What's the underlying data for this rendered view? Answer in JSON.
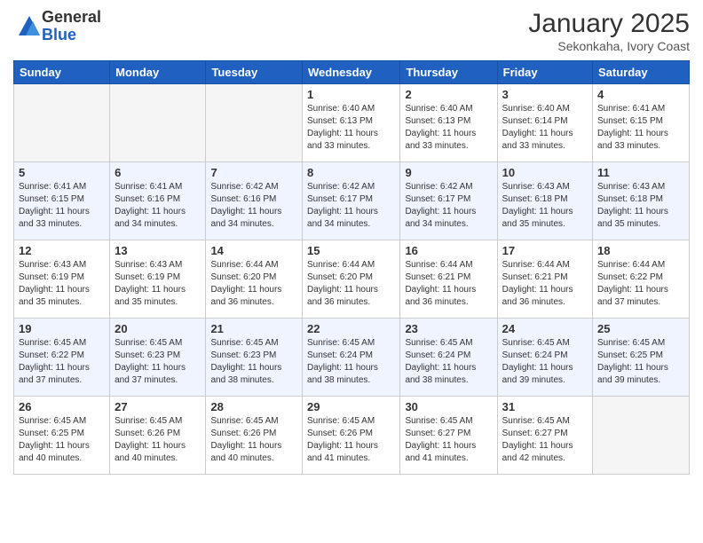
{
  "logo": {
    "general": "General",
    "blue": "Blue"
  },
  "header": {
    "title": "January 2025",
    "subtitle": "Sekonkaha, Ivory Coast"
  },
  "weekdays": [
    "Sunday",
    "Monday",
    "Tuesday",
    "Wednesday",
    "Thursday",
    "Friday",
    "Saturday"
  ],
  "weeks": [
    [
      {
        "day": "",
        "info": ""
      },
      {
        "day": "",
        "info": ""
      },
      {
        "day": "",
        "info": ""
      },
      {
        "day": "1",
        "info": "Sunrise: 6:40 AM\nSunset: 6:13 PM\nDaylight: 11 hours\nand 33 minutes."
      },
      {
        "day": "2",
        "info": "Sunrise: 6:40 AM\nSunset: 6:13 PM\nDaylight: 11 hours\nand 33 minutes."
      },
      {
        "day": "3",
        "info": "Sunrise: 6:40 AM\nSunset: 6:14 PM\nDaylight: 11 hours\nand 33 minutes."
      },
      {
        "day": "4",
        "info": "Sunrise: 6:41 AM\nSunset: 6:15 PM\nDaylight: 11 hours\nand 33 minutes."
      }
    ],
    [
      {
        "day": "5",
        "info": "Sunrise: 6:41 AM\nSunset: 6:15 PM\nDaylight: 11 hours\nand 33 minutes."
      },
      {
        "day": "6",
        "info": "Sunrise: 6:41 AM\nSunset: 6:16 PM\nDaylight: 11 hours\nand 34 minutes."
      },
      {
        "day": "7",
        "info": "Sunrise: 6:42 AM\nSunset: 6:16 PM\nDaylight: 11 hours\nand 34 minutes."
      },
      {
        "day": "8",
        "info": "Sunrise: 6:42 AM\nSunset: 6:17 PM\nDaylight: 11 hours\nand 34 minutes."
      },
      {
        "day": "9",
        "info": "Sunrise: 6:42 AM\nSunset: 6:17 PM\nDaylight: 11 hours\nand 34 minutes."
      },
      {
        "day": "10",
        "info": "Sunrise: 6:43 AM\nSunset: 6:18 PM\nDaylight: 11 hours\nand 35 minutes."
      },
      {
        "day": "11",
        "info": "Sunrise: 6:43 AM\nSunset: 6:18 PM\nDaylight: 11 hours\nand 35 minutes."
      }
    ],
    [
      {
        "day": "12",
        "info": "Sunrise: 6:43 AM\nSunset: 6:19 PM\nDaylight: 11 hours\nand 35 minutes."
      },
      {
        "day": "13",
        "info": "Sunrise: 6:43 AM\nSunset: 6:19 PM\nDaylight: 11 hours\nand 35 minutes."
      },
      {
        "day": "14",
        "info": "Sunrise: 6:44 AM\nSunset: 6:20 PM\nDaylight: 11 hours\nand 36 minutes."
      },
      {
        "day": "15",
        "info": "Sunrise: 6:44 AM\nSunset: 6:20 PM\nDaylight: 11 hours\nand 36 minutes."
      },
      {
        "day": "16",
        "info": "Sunrise: 6:44 AM\nSunset: 6:21 PM\nDaylight: 11 hours\nand 36 minutes."
      },
      {
        "day": "17",
        "info": "Sunrise: 6:44 AM\nSunset: 6:21 PM\nDaylight: 11 hours\nand 36 minutes."
      },
      {
        "day": "18",
        "info": "Sunrise: 6:44 AM\nSunset: 6:22 PM\nDaylight: 11 hours\nand 37 minutes."
      }
    ],
    [
      {
        "day": "19",
        "info": "Sunrise: 6:45 AM\nSunset: 6:22 PM\nDaylight: 11 hours\nand 37 minutes."
      },
      {
        "day": "20",
        "info": "Sunrise: 6:45 AM\nSunset: 6:23 PM\nDaylight: 11 hours\nand 37 minutes."
      },
      {
        "day": "21",
        "info": "Sunrise: 6:45 AM\nSunset: 6:23 PM\nDaylight: 11 hours\nand 38 minutes."
      },
      {
        "day": "22",
        "info": "Sunrise: 6:45 AM\nSunset: 6:24 PM\nDaylight: 11 hours\nand 38 minutes."
      },
      {
        "day": "23",
        "info": "Sunrise: 6:45 AM\nSunset: 6:24 PM\nDaylight: 11 hours\nand 38 minutes."
      },
      {
        "day": "24",
        "info": "Sunrise: 6:45 AM\nSunset: 6:24 PM\nDaylight: 11 hours\nand 39 minutes."
      },
      {
        "day": "25",
        "info": "Sunrise: 6:45 AM\nSunset: 6:25 PM\nDaylight: 11 hours\nand 39 minutes."
      }
    ],
    [
      {
        "day": "26",
        "info": "Sunrise: 6:45 AM\nSunset: 6:25 PM\nDaylight: 11 hours\nand 40 minutes."
      },
      {
        "day": "27",
        "info": "Sunrise: 6:45 AM\nSunset: 6:26 PM\nDaylight: 11 hours\nand 40 minutes."
      },
      {
        "day": "28",
        "info": "Sunrise: 6:45 AM\nSunset: 6:26 PM\nDaylight: 11 hours\nand 40 minutes."
      },
      {
        "day": "29",
        "info": "Sunrise: 6:45 AM\nSunset: 6:26 PM\nDaylight: 11 hours\nand 41 minutes."
      },
      {
        "day": "30",
        "info": "Sunrise: 6:45 AM\nSunset: 6:27 PM\nDaylight: 11 hours\nand 41 minutes."
      },
      {
        "day": "31",
        "info": "Sunrise: 6:45 AM\nSunset: 6:27 PM\nDaylight: 11 hours\nand 42 minutes."
      },
      {
        "day": "",
        "info": ""
      }
    ]
  ]
}
